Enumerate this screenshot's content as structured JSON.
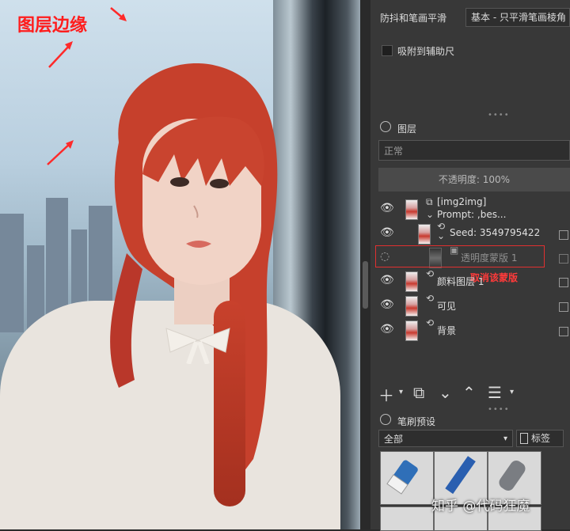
{
  "annotation": {
    "title": "图层边缘",
    "note": "取消该蒙版",
    "color": "#ff1d1d"
  },
  "panel": {
    "stabilizer_label": "防抖和笔画平滑",
    "stabilizer_value": "基本 - 只平滑笔画棱角",
    "snap_label": "吸附到辅助尺",
    "layers_header": "图层",
    "blend_mode": "正常",
    "opacity_label": "不透明度: 100%",
    "layers": [
      {
        "name": "[img2img]",
        "sub": "Prompt: ,bes..."
      },
      {
        "name": "Seed: 3549795422"
      },
      {
        "name": "透明度蒙版 1"
      },
      {
        "name": "颜料图层 1"
      },
      {
        "name": "可见"
      },
      {
        "name": "背景"
      }
    ],
    "toolbar_icons": [
      "plus-icon",
      "chevron-down-icon",
      "copy-icon",
      "arrow-down-icon",
      "arrow-up-icon",
      "settings-sliders-icon"
    ],
    "brush_header": "笔刷预设",
    "brush_filter": "全部",
    "tag_label": "标签"
  },
  "watermark": "知乎 @代码狂魔"
}
